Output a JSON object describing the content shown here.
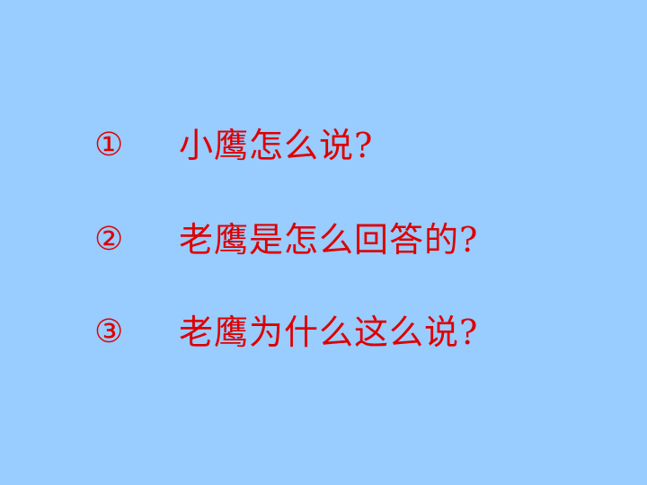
{
  "slide": {
    "background_color": "#99ccff",
    "text_color": "#dd0000",
    "questions": [
      {
        "number": "①",
        "text": "小鹰怎么说?"
      },
      {
        "number": "②",
        "text": "老鹰是怎么回答的?"
      },
      {
        "number": "③",
        "text": "老鹰为什么这么说?"
      }
    ]
  }
}
